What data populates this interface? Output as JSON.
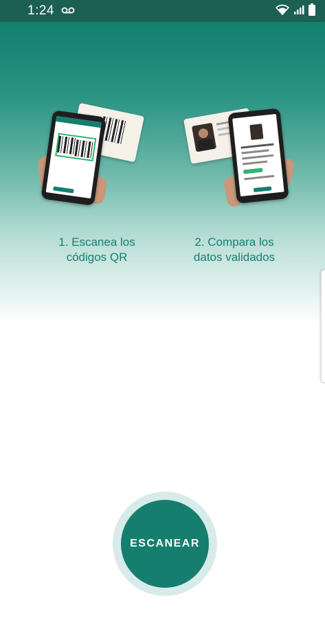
{
  "status_bar": {
    "time": "1:24",
    "icons": [
      "voicemail-icon",
      "wifi-icon",
      "signal-icon",
      "battery-icon"
    ]
  },
  "steps": [
    {
      "line1": "1. Escanea los",
      "line2": "códigos QR",
      "illustration": "scan-qr-illustration"
    },
    {
      "line1": "2. Compara los",
      "line2": "datos validados",
      "illustration": "compare-id-illustration"
    }
  ],
  "scan_button": {
    "label": "ESCANEAR"
  },
  "colors": {
    "status_bar": "#1b6052",
    "primary": "#167e6e",
    "caption_text": "#137f6f",
    "button_ring": "#d7ecea"
  }
}
